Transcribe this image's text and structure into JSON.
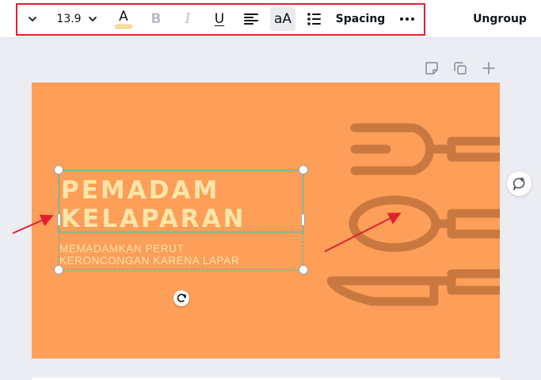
{
  "toolbar": {
    "font_size": "13.9",
    "text_color_letter": "A",
    "text_color_swatch": "#fbe3a3",
    "bold_label": "B",
    "italic_label": "I",
    "underline_label": "U",
    "case_label": "aA",
    "spacing_label": "Spacing",
    "ungroup_label": "Ungroup",
    "icons": [
      "chevron-down-icon",
      "chevron-down-icon",
      "align-left-icon",
      "bulleted-list-icon",
      "more-icon"
    ]
  },
  "page_actions": [
    "note-icon",
    "duplicate-icon",
    "add-page-icon"
  ],
  "design": {
    "background_color": "#fd9e59",
    "illustration_color": "#c97840",
    "text_color": "#fbe6a8",
    "title": "PEMADAM\nKELAPARAN",
    "subtitle": "MEMADAMKAN PERUT\nKERONCONGAN KARENA LAPAR"
  },
  "selection": {
    "color": "#26c4cf",
    "rotate_icon": "rotate-icon"
  },
  "comment_icon": "add-comment-icon",
  "annotations": {
    "highlight_color": "#e0202e",
    "arrows": [
      "annotation-arrow-left",
      "annotation-arrow-right"
    ]
  }
}
